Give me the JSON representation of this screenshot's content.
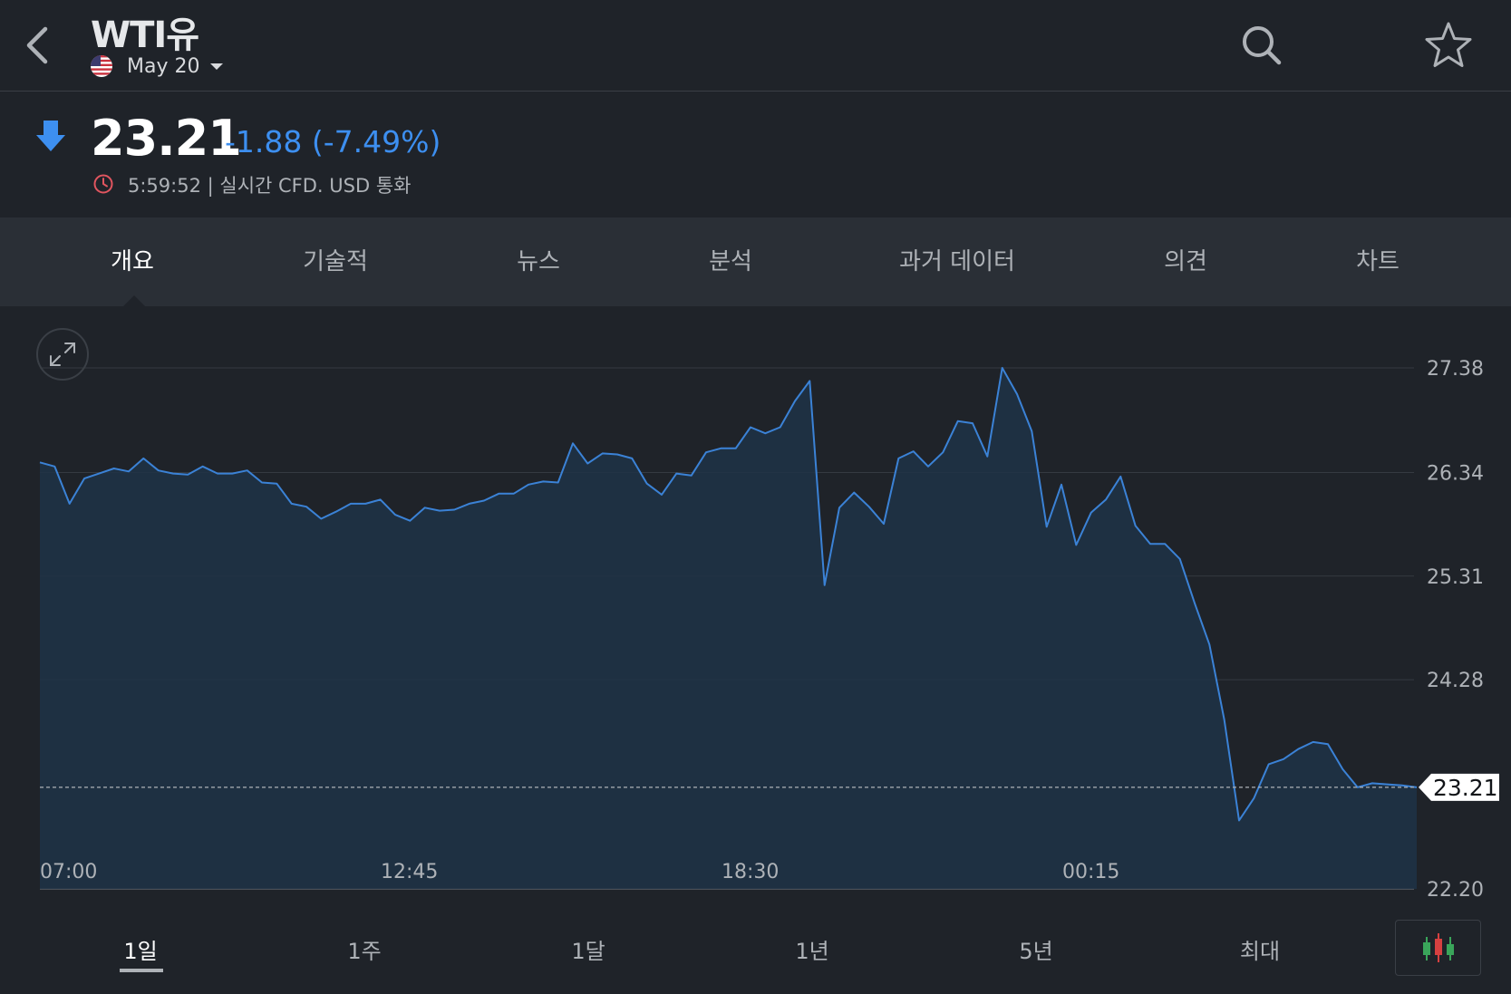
{
  "header": {
    "title": "WTI유",
    "contract": "May 20",
    "icons": [
      "back-chevron-icon",
      "us-flag-icon",
      "dropdown-caret-icon",
      "search-icon",
      "star-icon"
    ]
  },
  "quote": {
    "price": "23.21",
    "change": "-1.88 (-7.49%)",
    "meta": "5:59:52 | 실시간 CFD. USD 통화",
    "direction_color": "#3d8ff0"
  },
  "tabs": [
    {
      "label": "개요",
      "active": true
    },
    {
      "label": "기술적"
    },
    {
      "label": "뉴스"
    },
    {
      "label": "분석"
    },
    {
      "label": "과거 데이터"
    },
    {
      "label": "의견"
    },
    {
      "label": "차트"
    }
  ],
  "periods": [
    {
      "label": "1일",
      "active": true
    },
    {
      "label": "1주"
    },
    {
      "label": "1달"
    },
    {
      "label": "1년"
    },
    {
      "label": "5년"
    },
    {
      "label": "최대"
    }
  ],
  "colors": {
    "background": "#1f2329",
    "tab_bar": "#2a2f36",
    "line": "#3b82d6",
    "area_fill": "#1e3247",
    "accent_blue": "#3d8ff0"
  },
  "chart_data": {
    "type": "area",
    "ylim": [
      22.2,
      27.38
    ],
    "y_ticks": [
      "27.38",
      "26.34",
      "25.31",
      "24.28",
      "22.20"
    ],
    "x_ticks": [
      "07:00",
      "12:45",
      "18:30",
      "00:15"
    ],
    "last_label": "23.21",
    "last_value": 23.21,
    "grid": true,
    "values": [
      26.44,
      26.4,
      26.03,
      26.28,
      26.33,
      26.38,
      26.35,
      26.48,
      26.36,
      26.33,
      26.32,
      26.4,
      26.33,
      26.33,
      26.36,
      26.24,
      26.23,
      26.03,
      26.0,
      25.88,
      25.95,
      26.03,
      26.03,
      26.07,
      25.92,
      25.86,
      25.99,
      25.96,
      25.97,
      26.03,
      26.06,
      26.13,
      26.13,
      26.22,
      26.25,
      26.24,
      26.63,
      26.43,
      26.53,
      26.52,
      26.48,
      26.23,
      26.12,
      26.33,
      26.31,
      26.54,
      26.58,
      26.58,
      26.79,
      26.73,
      26.79,
      27.05,
      27.25,
      25.22,
      25.99,
      26.14,
      26.0,
      25.83,
      26.48,
      26.55,
      26.4,
      26.54,
      26.85,
      26.83,
      26.5,
      27.38,
      27.12,
      26.75,
      25.8,
      26.22,
      25.62,
      25.94,
      26.07,
      26.3,
      25.81,
      25.63,
      25.63,
      25.48,
      25.04,
      24.63,
      23.88,
      22.88,
      23.1,
      23.44,
      23.49,
      23.59,
      23.66,
      23.64,
      23.39,
      23.21,
      23.25,
      23.24,
      23.23,
      23.21
    ]
  }
}
